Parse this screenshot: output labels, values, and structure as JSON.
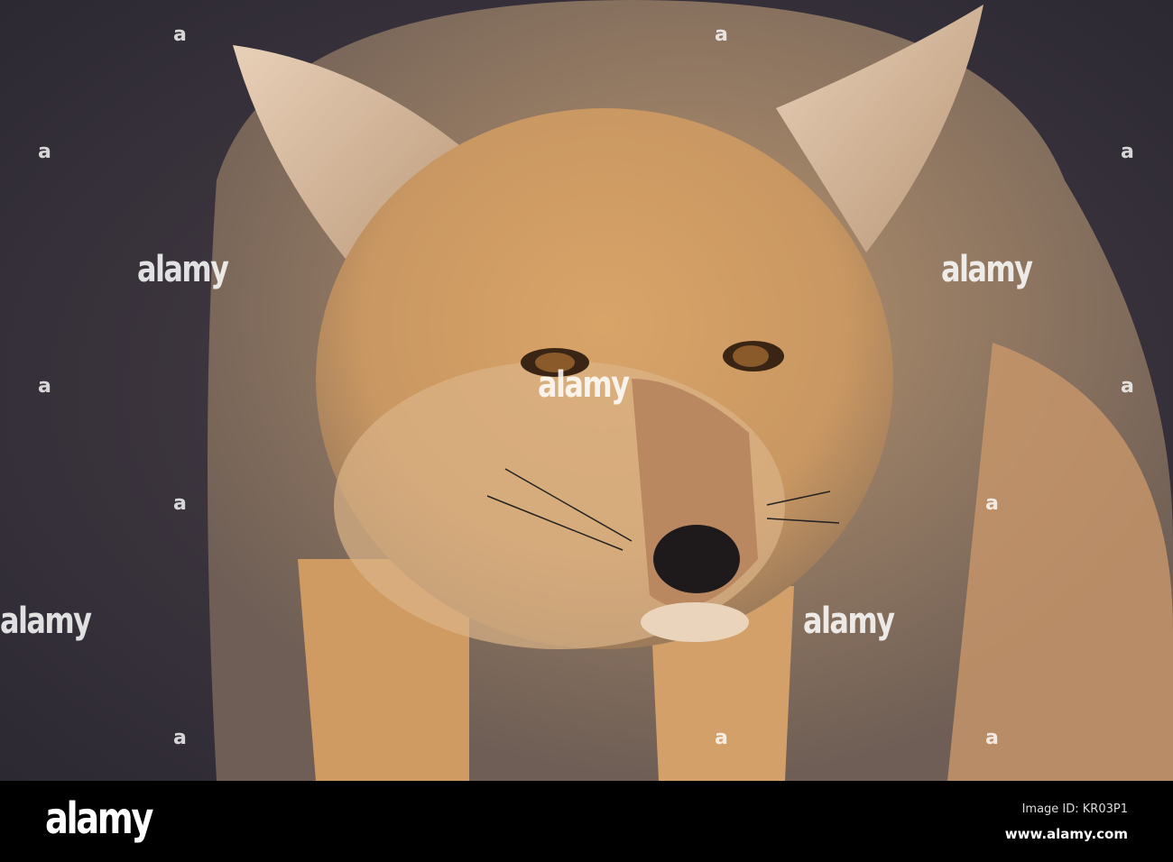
{
  "watermark": {
    "text": "alamy",
    "mark": "a"
  },
  "footer": {
    "logo": "alamy",
    "image_id": "Image ID: KR03P1",
    "site": "www.alamy.com"
  }
}
